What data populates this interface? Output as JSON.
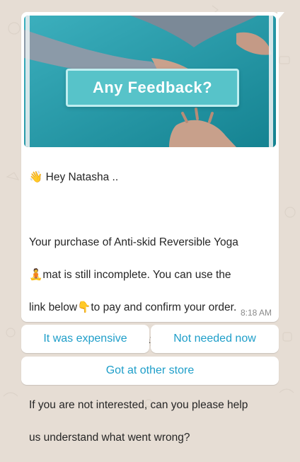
{
  "colors": {
    "background": "#e6ddd4",
    "bubble": "#ffffff",
    "link_blue": "#1e9ec9",
    "banner": "#57c3c9"
  },
  "banner": {
    "label": "Any Feedback?"
  },
  "message": {
    "greeting": "Hey Natasha ..",
    "line1": "Your purchase of Anti-skid Reversible Yoga",
    "line2": "mat is still incomplete. You can use the",
    "line3a": "link below",
    "line3b": "to pay and confirm your order.",
    "link": "https://yogicmats.com/pay-now",
    "line4": "If you are not interested, can you please help",
    "line5": "us understand what went wrong?",
    "time": "8:18 AM"
  },
  "quick_replies": [
    "It was expensive",
    "Not needed now",
    "Got at other store"
  ],
  "icons": [
    "waving-hand-emoji",
    "yoga-person-emoji",
    "pointing-down-emoji"
  ]
}
